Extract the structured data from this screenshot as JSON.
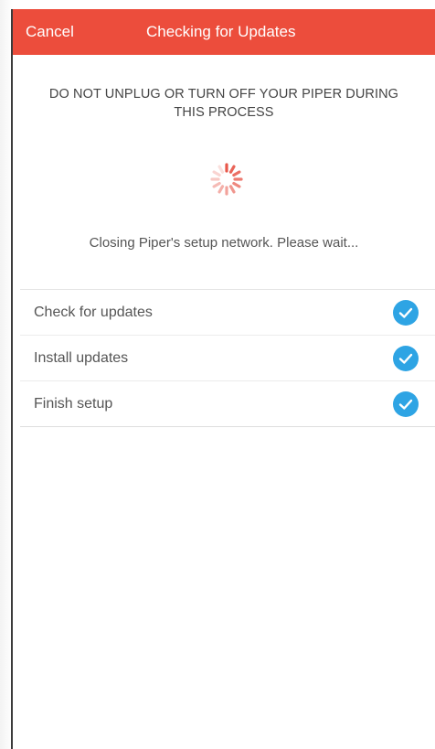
{
  "navbar": {
    "cancel_label": "Cancel",
    "title": "Checking for Updates",
    "color": "#ec4d3c"
  },
  "warning": {
    "line1": "DO NOT UNPLUG OR TURN OFF YOUR PIPER DURING",
    "line2": "THIS PROCESS"
  },
  "spinner": {
    "icon": "loading-spinner-icon",
    "color": "#e8574a"
  },
  "status_text": "Closing Piper's setup network. Please wait...",
  "steps": [
    {
      "label": "Check for updates",
      "state": "complete",
      "icon": "checkmark-circle-icon"
    },
    {
      "label": "Install updates",
      "state": "complete",
      "icon": "checkmark-circle-icon"
    },
    {
      "label": "Finish setup",
      "state": "complete",
      "icon": "checkmark-circle-icon"
    }
  ],
  "colors": {
    "check": "#2ea4e4",
    "text": "#555555"
  }
}
